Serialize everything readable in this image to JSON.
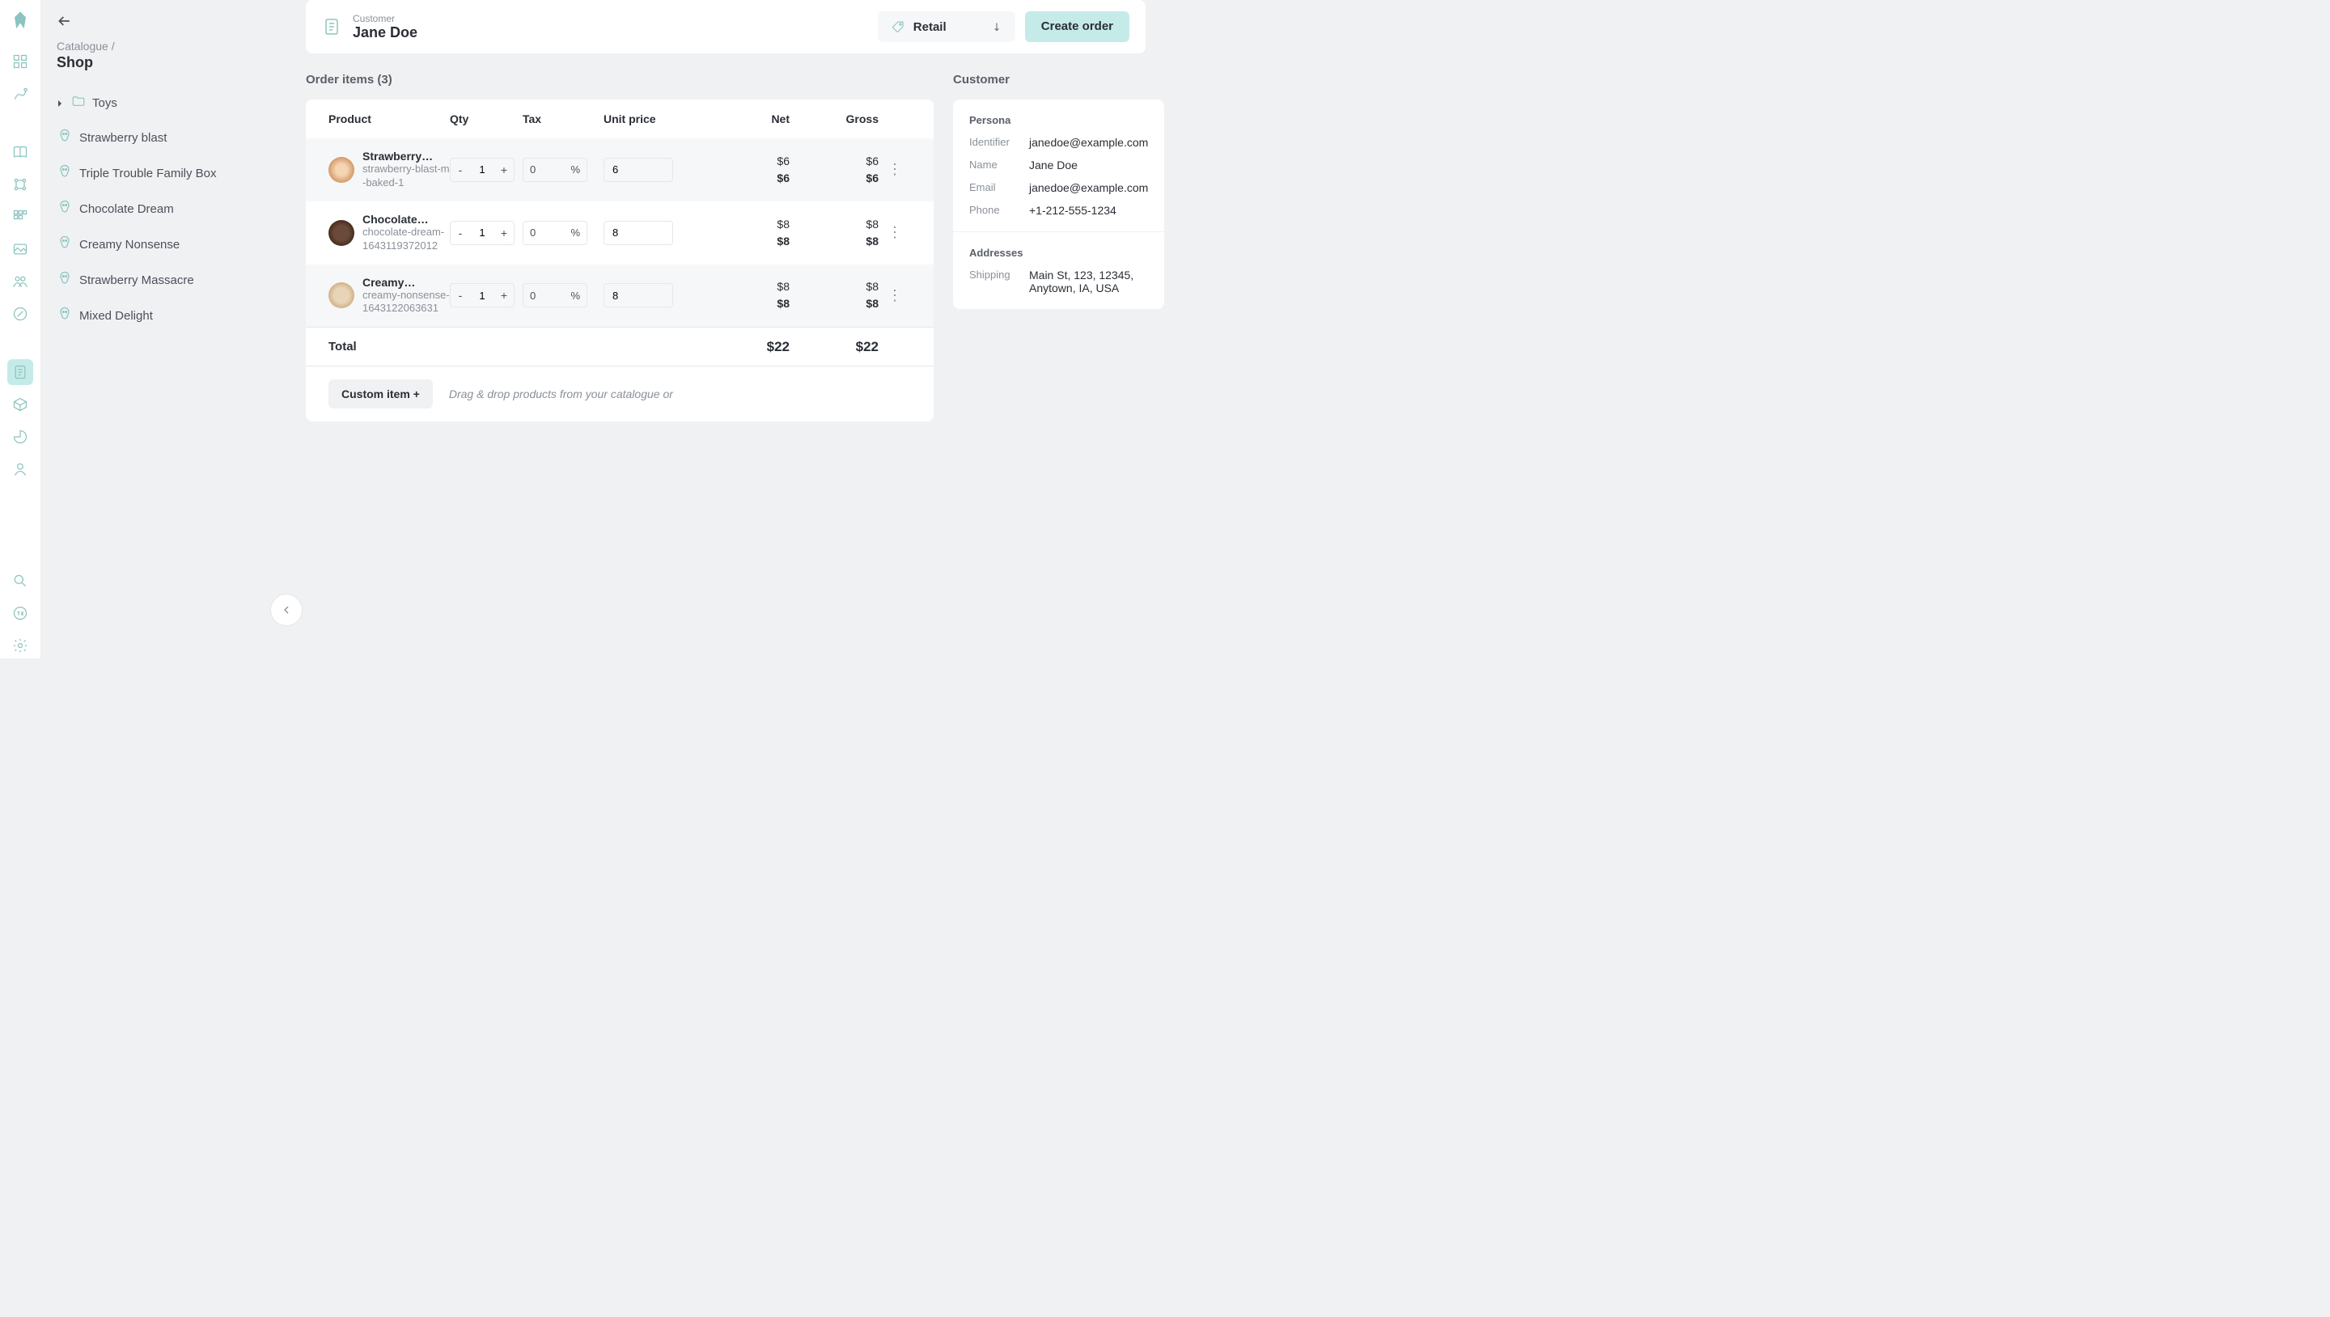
{
  "breadcrumb": {
    "parent": "Catalogue",
    "current": "Shop"
  },
  "sidebar": {
    "folder": "Toys",
    "products": [
      "Strawberry blast",
      "Triple Trouble Family Box",
      "Chocolate Dream",
      "Creamy Nonsense",
      "Strawberry Massacre",
      "Mixed Delight"
    ]
  },
  "header": {
    "customer_label": "Customer",
    "customer_name": "Jane Doe",
    "price_variant": "Retail",
    "create_order": "Create order"
  },
  "order": {
    "title": "Order items (3)",
    "columns": {
      "product": "Product",
      "qty": "Qty",
      "tax": "Tax",
      "unit_price": "Unit price",
      "net": "Net",
      "gross": "Gross"
    },
    "items": [
      {
        "name": "Strawberry…",
        "sku": "strawberry-blast-m-baked-1",
        "qty": "1",
        "tax": "0",
        "pct": "%",
        "price": "6",
        "net1": "$6",
        "net2": "$6",
        "gross1": "$6",
        "gross2": "$6",
        "thumb": ""
      },
      {
        "name": "Chocolate…",
        "sku": "chocolate-dream-1643119372012",
        "qty": "1",
        "tax": "0",
        "pct": "%",
        "price": "8",
        "net1": "$8",
        "net2": "$8",
        "gross1": "$8",
        "gross2": "$8",
        "thumb": "choc"
      },
      {
        "name": "Creamy…",
        "sku": "creamy-nonsense-1643122063631",
        "qty": "1",
        "tax": "0",
        "pct": "%",
        "price": "8",
        "net1": "$8",
        "net2": "$8",
        "gross1": "$8",
        "gross2": "$8",
        "thumb": "cream"
      }
    ],
    "total_label": "Total",
    "total_net": "$22",
    "total_gross": "$22",
    "custom_item": "Custom item +",
    "hint": "Drag & drop products from your catalogue or"
  },
  "customer": {
    "title": "Customer",
    "persona_title": "Persona",
    "identifier_label": "Identifier",
    "identifier": "janedoe@example.com",
    "name_label": "Name",
    "name": "Jane Doe",
    "email_label": "Email",
    "email": "janedoe@example.com",
    "phone_label": "Phone",
    "phone": "+1-212-555-1234",
    "addresses_title": "Addresses",
    "shipping_label": "Shipping",
    "shipping": "Main St, 123, 12345, Anytown, IA, USA"
  }
}
